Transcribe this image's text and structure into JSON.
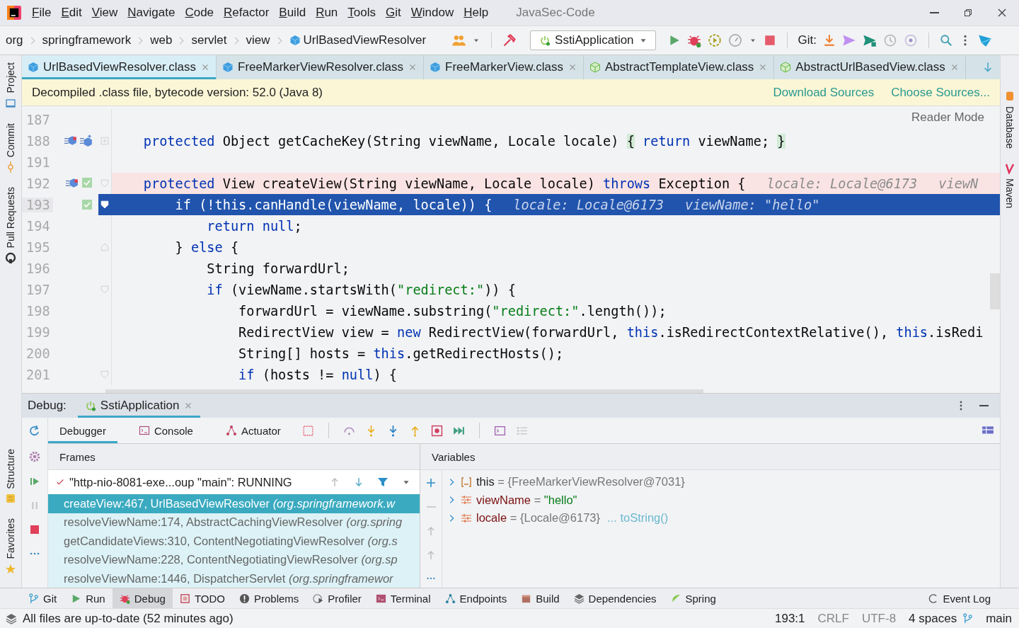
{
  "title_bar": {
    "menu": [
      "File",
      "Edit",
      "View",
      "Navigate",
      "Code",
      "Refactor",
      "Build",
      "Run",
      "Tools",
      "Git",
      "Window",
      "Help"
    ],
    "project": "JavaSec-Code"
  },
  "breadcrumbs": [
    "org",
    "springframework",
    "web",
    "servlet",
    "view",
    "UrlBasedViewResolver"
  ],
  "run_config": "SstiApplication",
  "git_label": "Git:",
  "editor_tabs": [
    {
      "label": "UrlBasedViewResolver.class",
      "kind": "class",
      "selected": true
    },
    {
      "label": "FreeMarkerViewResolver.class",
      "kind": "class",
      "selected": false
    },
    {
      "label": "FreeMarkerView.class",
      "kind": "class",
      "selected": false
    },
    {
      "label": "AbstractTemplateView.class",
      "kind": "abstract",
      "selected": false
    },
    {
      "label": "AbstractUrlBasedView.class",
      "kind": "abstract",
      "selected": false
    }
  ],
  "banner": {
    "text": "Decompiled .class file, bytecode version: 52.0 (Java 8)",
    "links": [
      "Download Sources",
      "Choose Sources..."
    ]
  },
  "reader_mode": "Reader Mode",
  "code_lines": [
    {
      "number": "187"
    },
    {
      "number": "188",
      "overrides": true,
      "overridden": true,
      "folded": true,
      "code": [
        {
          "text": "    protected",
          "kind": "keyword"
        },
        {
          "text": " Object getCacheKey(String viewName, Locale locale) ",
          "kind": "plain"
        },
        {
          "text": "{",
          "kind": "folded"
        },
        {
          "text": " return",
          "kind": "keyword"
        },
        {
          "text": " viewName; ",
          "kind": "plain"
        },
        {
          "text": "}",
          "kind": "folded"
        }
      ]
    },
    {
      "number": "191"
    },
    {
      "number": "192",
      "breakpoint": true,
      "overrides": true,
      "checked": true,
      "fold_start": true,
      "code": [
        {
          "text": "    protected",
          "kind": "keyword"
        },
        {
          "text": " View createView(String viewName, Locale locale) ",
          "kind": "plain"
        },
        {
          "text": "throws",
          "kind": "keyword"
        },
        {
          "text": " Exception {",
          "kind": "plain"
        }
      ],
      "hints": [
        "locale: Locale@6173",
        "viewN"
      ]
    },
    {
      "number": "193",
      "current": true,
      "checked": true,
      "fold_start": true,
      "code": [
        {
          "text": "        if",
          "kind": "keyword"
        },
        {
          "text": " (!",
          "kind": "plain"
        },
        {
          "text": "this",
          "kind": "keyword"
        },
        {
          "text": ".canHandle(viewName, locale)) {",
          "kind": "plain"
        }
      ],
      "hints": [
        "locale: Locale@6173",
        "viewName: \"hello\""
      ]
    },
    {
      "number": "194",
      "code": [
        {
          "text": "            return",
          "kind": "keyword"
        },
        {
          "text": " null",
          "kind": "keyword"
        },
        {
          "text": ";",
          "kind": "plain"
        }
      ]
    },
    {
      "number": "195",
      "fold_end": true,
      "code": [
        {
          "text": "        } ",
          "kind": "plain"
        },
        {
          "text": "else",
          "kind": "keyword"
        },
        {
          "text": " {",
          "kind": "plain"
        }
      ]
    },
    {
      "number": "196",
      "code": [
        {
          "text": "            String forwardUrl;",
          "kind": "plain"
        }
      ]
    },
    {
      "number": "197",
      "fold_start": true,
      "code": [
        {
          "text": "            if",
          "kind": "keyword"
        },
        {
          "text": " (viewName.startsWith(",
          "kind": "plain"
        },
        {
          "text": "\"redirect:\"",
          "kind": "string"
        },
        {
          "text": ")) {",
          "kind": "plain"
        }
      ]
    },
    {
      "number": "198",
      "code": [
        {
          "text": "                forwardUrl = viewName.substring(",
          "kind": "plain"
        },
        {
          "text": "\"redirect:\"",
          "kind": "string"
        },
        {
          "text": ".length());",
          "kind": "plain"
        }
      ]
    },
    {
      "number": "199",
      "code": [
        {
          "text": "                RedirectView view = ",
          "kind": "plain"
        },
        {
          "text": "new",
          "kind": "keyword"
        },
        {
          "text": " RedirectView(forwardUrl, ",
          "kind": "plain"
        },
        {
          "text": "this",
          "kind": "keyword"
        },
        {
          "text": ".isRedirectContextRelative(), ",
          "kind": "plain"
        },
        {
          "text": "this",
          "kind": "keyword"
        },
        {
          "text": ".isRedi",
          "kind": "plain"
        }
      ]
    },
    {
      "number": "200",
      "code": [
        {
          "text": "                String[] hosts = ",
          "kind": "plain"
        },
        {
          "text": "this",
          "kind": "keyword"
        },
        {
          "text": ".getRedirectHosts();",
          "kind": "plain"
        }
      ]
    },
    {
      "number": "201",
      "fold_start": true,
      "code": [
        {
          "text": "                if",
          "kind": "keyword"
        },
        {
          "text": " (hosts != ",
          "kind": "plain"
        },
        {
          "text": "null",
          "kind": "keyword"
        },
        {
          "text": ") {",
          "kind": "plain"
        }
      ]
    }
  ],
  "left_stripe": [
    "Project",
    "Commit",
    "Pull Requests",
    "Structure",
    "Favorites"
  ],
  "right_stripe": [
    "Database",
    "Maven"
  ],
  "debug": {
    "label": "Debug:",
    "session": "SstiApplication",
    "tabs": [
      {
        "label": "Debugger",
        "selected": true
      },
      {
        "label": "Console",
        "selected": false
      },
      {
        "label": "Actuator",
        "selected": false
      }
    ],
    "frames": {
      "title": "Frames",
      "thread": "\"http-nio-8081-exe...oup \"main\": RUNNING",
      "items": [
        {
          "method": "createView:467, UrlBasedViewResolver",
          "package": "(org.springframework.w",
          "selected": true
        },
        {
          "method": "resolveViewName:174, AbstractCachingViewResolver",
          "package": "(org.spring",
          "selected": false
        },
        {
          "method": "getCandidateViews:310, ContentNegotiatingViewResolver",
          "package": "(org.s",
          "selected": false
        },
        {
          "method": "resolveViewName:228, ContentNegotiatingViewResolver",
          "package": "(org.sp",
          "selected": false
        },
        {
          "method": "resolveViewName:1446, DispatcherServlet",
          "package": "(org.springframewor",
          "selected": false
        }
      ]
    },
    "variables": {
      "title": "Variables",
      "items": [
        {
          "name": "this",
          "kind": "object",
          "eq": "=",
          "value": "{FreeMarkerViewResolver@7031}"
        },
        {
          "name": "viewName",
          "kind": "field",
          "eq": "=",
          "value": "\"hello\"",
          "string_value": true
        },
        {
          "name": "locale",
          "kind": "field",
          "eq": "=",
          "value": "{Locale@6173}",
          "extra": "... toString()"
        }
      ]
    }
  },
  "tool_windows": [
    {
      "label": "Git",
      "selected": false
    },
    {
      "label": "Run",
      "selected": false
    },
    {
      "label": "Debug",
      "selected": true
    },
    {
      "label": "TODO",
      "selected": false
    },
    {
      "label": "Problems",
      "selected": false
    },
    {
      "label": "Profiler",
      "selected": false
    },
    {
      "label": "Terminal",
      "selected": false
    },
    {
      "label": "Endpoints",
      "selected": false
    },
    {
      "label": "Build",
      "selected": false
    },
    {
      "label": "Dependencies",
      "selected": false
    },
    {
      "label": "Spring",
      "selected": false
    },
    {
      "label": "Event Log",
      "selected": false
    }
  ],
  "status_bar": {
    "message": "All files are up-to-date (52 minutes ago)",
    "items": [
      "193:1",
      "CRLF",
      "UTF-8",
      "4 spaces",
      "main"
    ]
  }
}
